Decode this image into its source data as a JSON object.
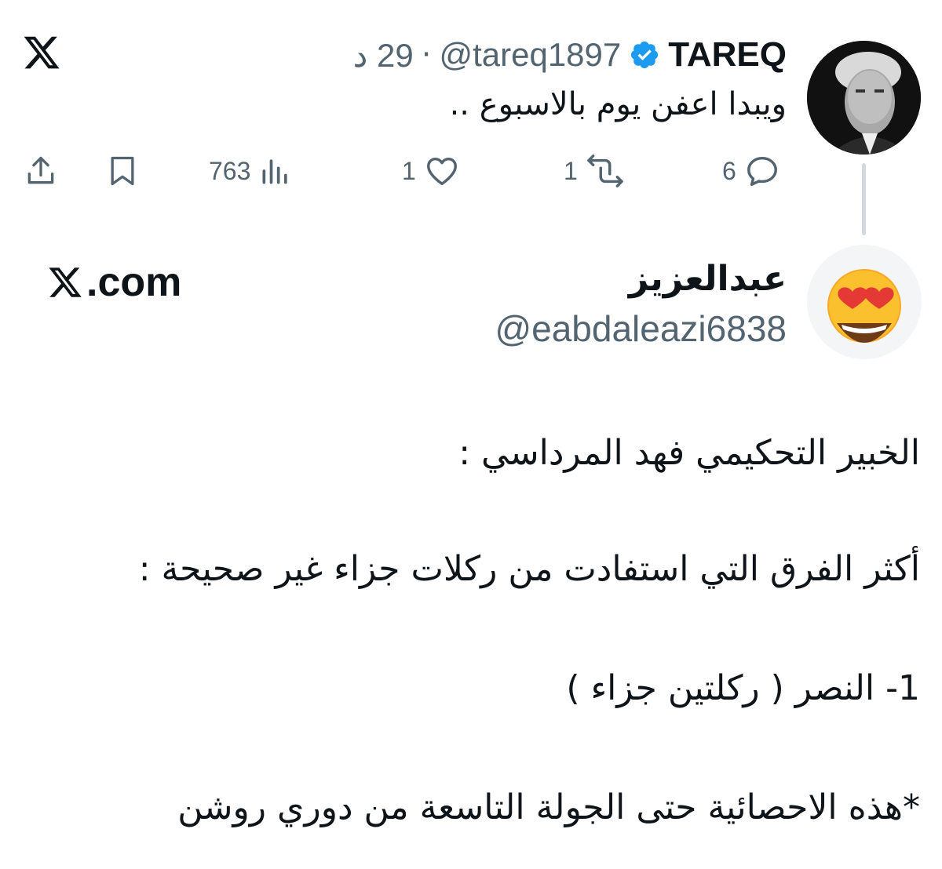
{
  "tweet": {
    "author_name": "TAREQ",
    "handle": "@tareq1897",
    "separator": "·",
    "time": "29 د",
    "text": "ويبدا اعفن يوم بالاسبوع ..",
    "views": "763",
    "likes": "1",
    "retweets": "1",
    "replies": "6"
  },
  "card": {
    "name": "عبدالعزيز",
    "handle": "@eabdaleazi6838",
    "brand": ".com",
    "lines": [
      "الخبير التحكيمي فهد المرداسي :",
      "أكثر الفرق التي استفادت من ركلات جزاء غير صحيحة :",
      "1- النصر ( ركلتين جزاء )",
      "*هذه الاحصائية حتى الجولة التاسعة من دوري روشن"
    ]
  },
  "colors": {
    "text": "#0f1419",
    "muted": "#536471",
    "verified": "#1d9bf0",
    "thread_line": "#cfd9de"
  },
  "icons": [
    "x-logo-icon",
    "verified-badge-icon",
    "share-icon",
    "bookmark-icon",
    "views-icon",
    "like-icon",
    "retweet-icon",
    "reply-icon",
    "emoji-heart-eyes-icon"
  ]
}
